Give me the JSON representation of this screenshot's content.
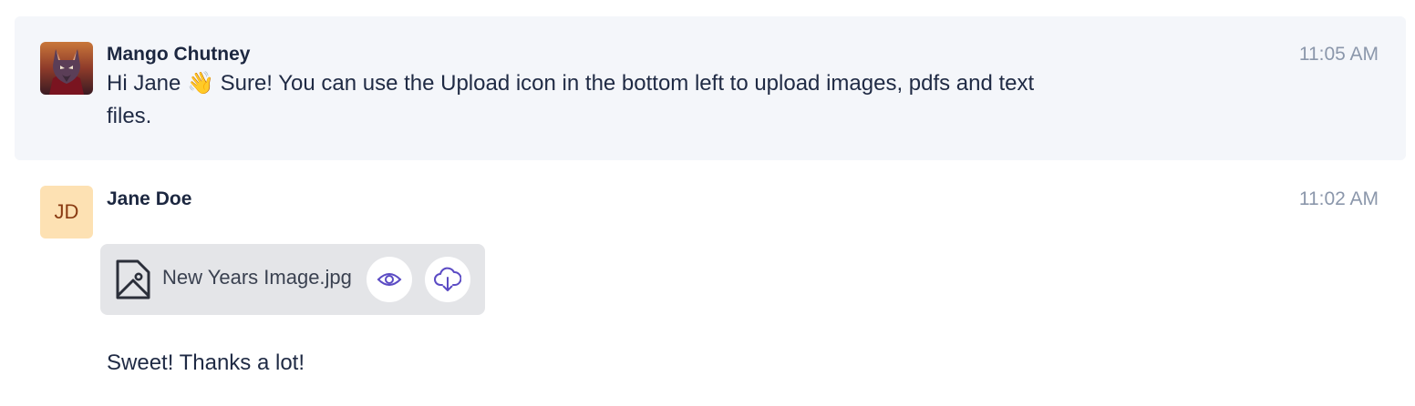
{
  "messages": [
    {
      "author": "Mango Chutney",
      "time": "11:05 AM",
      "text_before_emoji": "Hi Jane ",
      "emoji": "👋",
      "text_after_emoji": " Sure! You can use the Upload icon in the bottom left to upload images, pdfs and text files.",
      "avatar_icon": "user-photo-avatar",
      "highlighted": true
    },
    {
      "author": "Jane Doe",
      "initials": "JD",
      "time": "11:02 AM",
      "attachment": {
        "file_name": "New Years Image.jpg",
        "file_icon": "image-file-icon",
        "view_icon": "eye-icon",
        "download_icon": "cloud-download-icon"
      },
      "text": "Sweet! Thanks a lot!",
      "highlighted": false
    }
  ],
  "colors": {
    "highlight_bg": "#f4f6fa",
    "initials_bg": "#fde1b3",
    "initials_fg": "#8a3b12",
    "timestamp": "#8b97ab",
    "accent_icon": "#5b4bc4"
  }
}
